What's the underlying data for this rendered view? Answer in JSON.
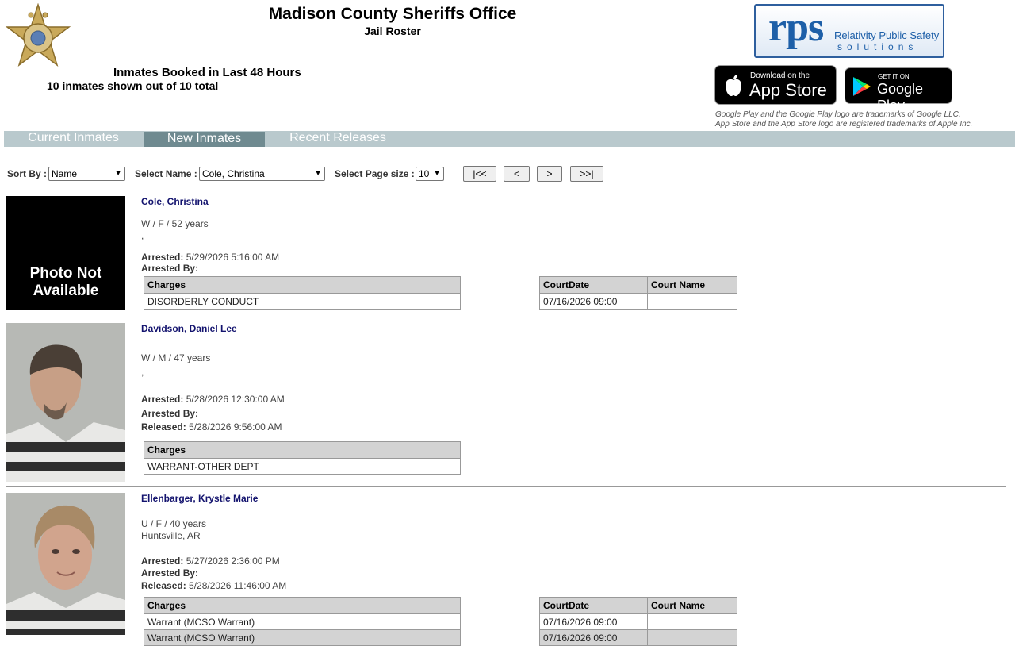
{
  "header": {
    "title": "Madison County Sheriffs Office",
    "subtitle": "Jail Roster",
    "booked_heading": "Inmates Booked in Last 48 Hours",
    "shown_count": "10 inmates shown out of 10 total"
  },
  "branding": {
    "rps_letters": "rps",
    "rps_tag_line1": "Relativity Public Safety",
    "rps_tag_line2": "solutions",
    "app_store_small": "Download on the",
    "app_store_big": "App Store",
    "google_small": "GET IT ON",
    "google_big": "Google Play",
    "trademark_line1": "Google Play and the Google Play logo are trademarks of Google LLC.",
    "trademark_line2": "App Store and the App Store logo are registered trademarks of Apple Inc."
  },
  "tabs": [
    {
      "label": "Current Inmates"
    },
    {
      "label": "New Inmates"
    },
    {
      "label": "Recent Releases"
    }
  ],
  "controls": {
    "sort_label": "Sort By :",
    "sort_value": "Name",
    "select_name_label": "Select Name :",
    "select_name_value": "Cole, Christina",
    "page_size_label": "Select Page size :",
    "page_size_value": "10",
    "first": "|<<",
    "prev": "<",
    "next": ">",
    "last": ">>|"
  },
  "labels": {
    "arrested": "Arrested:",
    "arrested_by": "Arrested By:",
    "released": "Released:",
    "charges": "Charges",
    "court_date": "CourtDate",
    "court_name": "Court Name",
    "photo_na_line1": "Photo Not",
    "photo_na_line2": "Available"
  },
  "inmates": [
    {
      "name": "Cole, Christina",
      "demographics": "W / F / 52 years",
      "location": ",",
      "arrested": "5/29/2026 5:16:00 AM",
      "arrested_by": "",
      "charges": [
        "DISORDERLY CONDUCT"
      ],
      "court": [
        {
          "date": "07/16/2026 09:00",
          "name": ""
        }
      ]
    },
    {
      "name": "Davidson, Daniel Lee",
      "demographics": "W / M / 47 years",
      "location": ",",
      "arrested": "5/28/2026 12:30:00 AM",
      "arrested_by": "",
      "released": "5/28/2026 9:56:00 AM",
      "charges": [
        "WARRANT-OTHER DEPT"
      ]
    },
    {
      "name": "Ellenbarger, Krystle Marie",
      "demographics": "U / F / 40 years",
      "location": "Huntsville, AR",
      "arrested": "5/27/2026 2:36:00 PM",
      "arrested_by": "",
      "released": "5/28/2026 11:46:00 AM",
      "charges": [
        "Warrant (MCSO Warrant)",
        "Warrant (MCSO Warrant)"
      ],
      "court": [
        {
          "date": "07/16/2026 09:00",
          "name": ""
        },
        {
          "date": "07/16/2026 09:00",
          "name": ""
        }
      ]
    }
  ],
  "colors": {
    "tab_bar": "#b9c9cd",
    "tab_active": "#6f8a90",
    "name_link": "#13136e",
    "table_header": "#d3d3d3"
  }
}
